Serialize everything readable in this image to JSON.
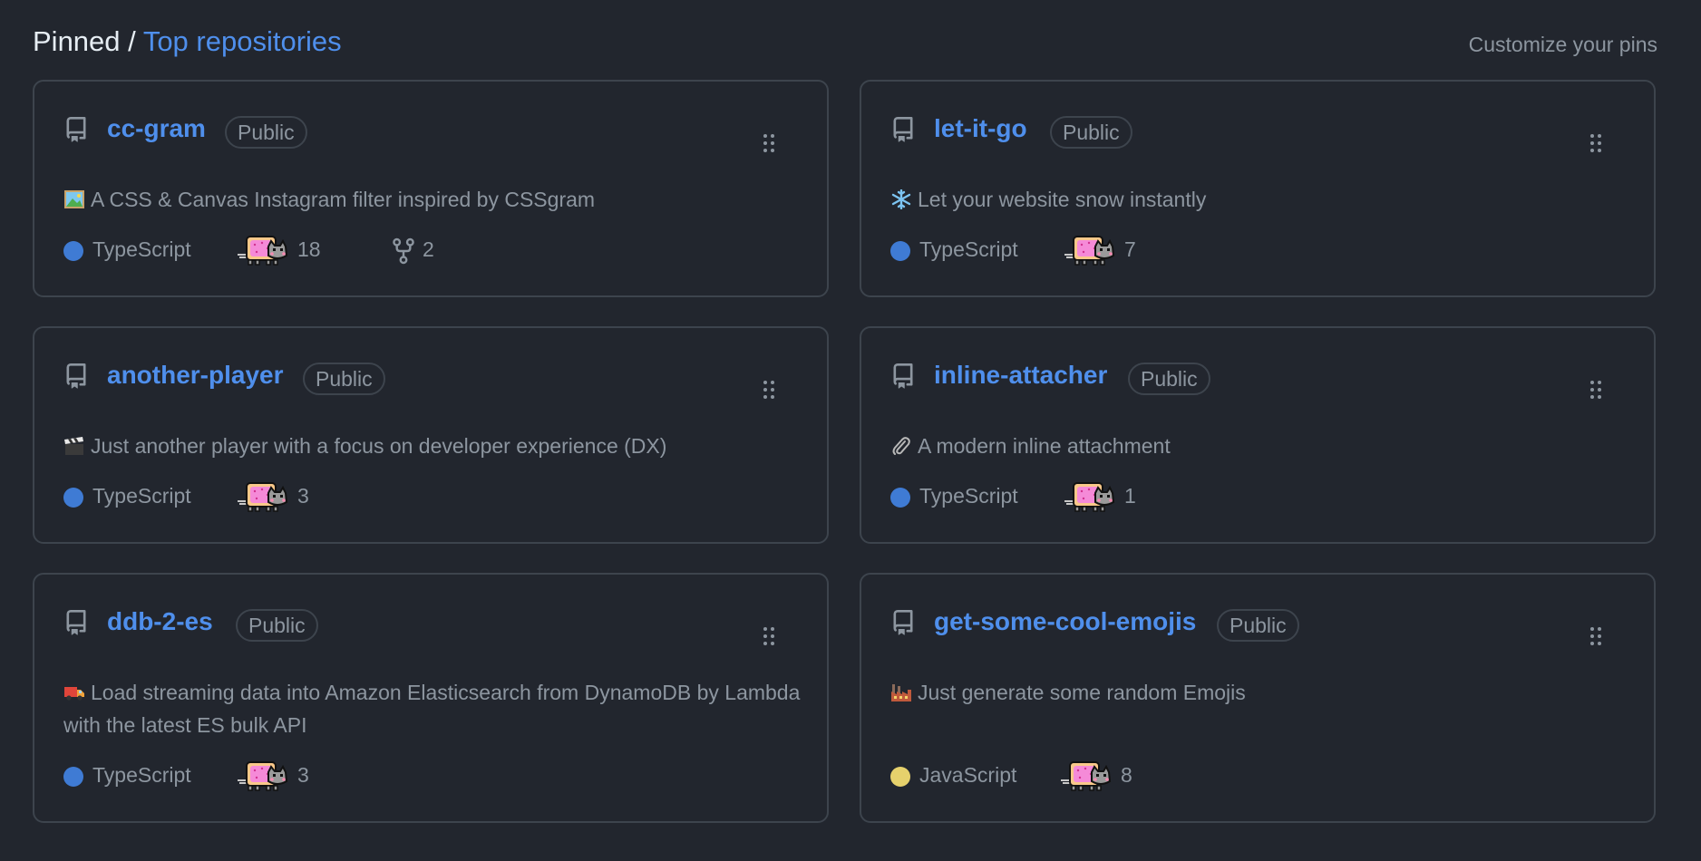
{
  "header": {
    "pinned_label": "Pinned",
    "separator": " / ",
    "top_label": "Top repositories",
    "customize_label": "Customize your pins"
  },
  "colors": {
    "background": "#22262e",
    "link_blue": "#4f8fec",
    "muted_text": "#8d96a0",
    "border": "#3d444d",
    "typescript": "#3178c6",
    "javascript": "#f1e05a"
  },
  "icons": {
    "repo": "repo-icon",
    "drag": "drag-handle-icon",
    "star": "nyan-cat-star-icon",
    "fork": "fork-icon"
  },
  "repos": [
    {
      "name": "cc-gram",
      "visibility": "Public",
      "emoji": "framed-picture",
      "description": "A CSS & Canvas Instagram filter inspired by CSSgram",
      "language": "TypeScript",
      "language_color": "#3178c6",
      "stars": "18",
      "forks": "2"
    },
    {
      "name": "let-it-go",
      "visibility": "Public",
      "emoji": "snowflake",
      "description": "Let your website snow instantly",
      "language": "TypeScript",
      "language_color": "#3178c6",
      "stars": "7"
    },
    {
      "name": "another-player",
      "visibility": "Public",
      "emoji": "clapper-board",
      "description": "Just another player with a focus on developer experience (DX)",
      "language": "TypeScript",
      "language_color": "#3178c6",
      "stars": "3"
    },
    {
      "name": "inline-attacher",
      "visibility": "Public",
      "emoji": "paperclip",
      "description": "A modern inline attachment",
      "language": "TypeScript",
      "language_color": "#3178c6",
      "stars": "1"
    },
    {
      "name": "ddb-2-es",
      "visibility": "Public",
      "emoji": "delivery-truck",
      "description": "Load streaming data into Amazon Elasticsearch from DynamoDB by Lambda with the latest ES bulk API",
      "language": "TypeScript",
      "language_color": "#3178c6",
      "stars": "3"
    },
    {
      "name": "get-some-cool-emojis",
      "visibility": "Public",
      "emoji": "factory",
      "description": "Just generate some random Emojis",
      "language": "JavaScript",
      "language_color": "#f1e05a",
      "stars": "8"
    }
  ]
}
